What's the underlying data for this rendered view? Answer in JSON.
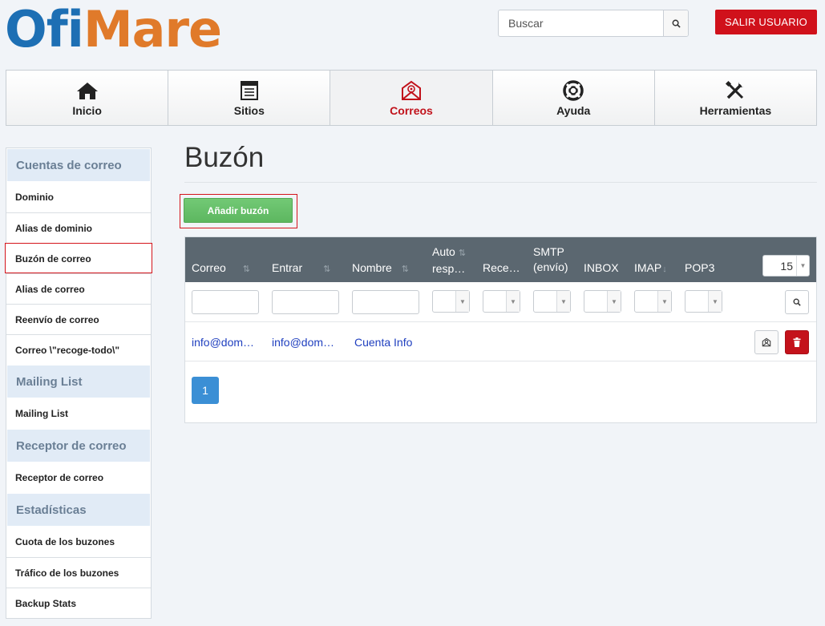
{
  "logo": {
    "part1": "Ofi",
    "part2": "Mare"
  },
  "header": {
    "search_placeholder": "Buscar",
    "logout_label": "SALIR USUARIO"
  },
  "nav": [
    {
      "label": "Inicio",
      "icon": "home-icon"
    },
    {
      "label": "Sitios",
      "icon": "sites-icon"
    },
    {
      "label": "Correos",
      "icon": "mail-icon",
      "active": true
    },
    {
      "label": "Ayuda",
      "icon": "help-icon"
    },
    {
      "label": "Herramientas",
      "icon": "tools-icon"
    }
  ],
  "sidebar": {
    "sections": [
      {
        "title": "Cuentas de correo",
        "items": [
          "Dominio",
          "Alias de dominio",
          "Buzón de correo",
          "Alias de correo",
          "Reenvío de correo",
          "Correo \\\"recoge-todo\\\""
        ]
      },
      {
        "title": "Mailing List",
        "items": [
          "Mailing List"
        ]
      },
      {
        "title": "Receptor de correo",
        "items": [
          "Receptor de correo"
        ]
      },
      {
        "title": "Estadísticas",
        "items": [
          "Cuota de los buzones",
          "Tráfico de los buzones",
          "Backup Stats"
        ]
      }
    ],
    "selected": "Buzón de correo"
  },
  "main": {
    "title": "Buzón",
    "add_button": "Añadir buzón",
    "table": {
      "columns": [
        {
          "l1": "Correo",
          "l2": ""
        },
        {
          "l1": "Entrar",
          "l2": ""
        },
        {
          "l1": "Nombre",
          "l2": ""
        },
        {
          "l1": "Auto",
          "l2": "resp…"
        },
        {
          "l1": "Rece…",
          "l2": ""
        },
        {
          "l1": "SMTP",
          "l2": "(envío)"
        },
        {
          "l1": "INBOX",
          "l2": ""
        },
        {
          "l1": "IMAP",
          "l2": ""
        },
        {
          "l1": "POP3",
          "l2": ""
        }
      ],
      "page_size": "15",
      "rows": [
        {
          "correo": "info@dom…",
          "entrar": "info@dom…",
          "nombre": "Cuenta Info"
        }
      ],
      "current_page": "1"
    }
  },
  "colors": {
    "brand_blue": "#1d6fb4",
    "brand_orange": "#e07a2a",
    "logout_red": "#d0111b",
    "add_green": "#5db760",
    "table_header": "#5b6770",
    "pager_blue": "#3b8fd5"
  }
}
